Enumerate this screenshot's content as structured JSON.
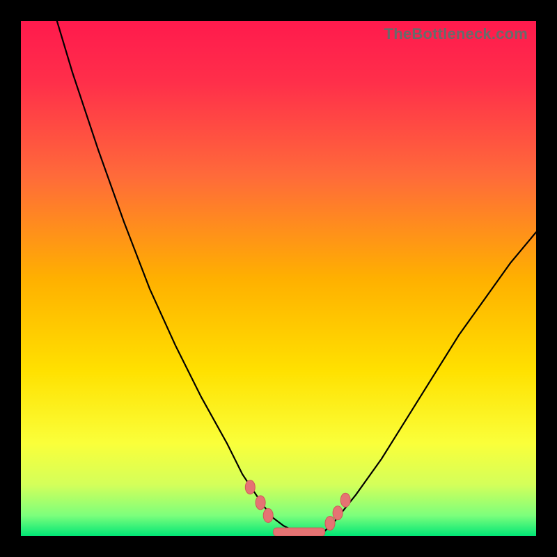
{
  "watermark": "TheBottleneck.com",
  "colors": {
    "frame": "#000000",
    "gradient_stops": [
      {
        "offset": 0.0,
        "color": "#ff1a4d"
      },
      {
        "offset": 0.12,
        "color": "#ff2f4a"
      },
      {
        "offset": 0.3,
        "color": "#ff6a3a"
      },
      {
        "offset": 0.5,
        "color": "#ffb000"
      },
      {
        "offset": 0.68,
        "color": "#ffe100"
      },
      {
        "offset": 0.82,
        "color": "#faff3a"
      },
      {
        "offset": 0.9,
        "color": "#d4ff5a"
      },
      {
        "offset": 0.96,
        "color": "#7cff7c"
      },
      {
        "offset": 1.0,
        "color": "#00e676"
      }
    ],
    "curve": "#000000",
    "marker_fill": "#e57373",
    "marker_stroke": "#d05858"
  },
  "chart_data": {
    "type": "line",
    "title": "",
    "xlabel": "",
    "ylabel": "",
    "xlim": [
      0,
      100
    ],
    "ylim": [
      0,
      100
    ],
    "grid": false,
    "legend": false,
    "series": [
      {
        "name": "bottleneck-curve",
        "x": [
          7,
          10,
          15,
          20,
          25,
          30,
          35,
          40,
          43,
          45,
          47,
          49,
          51,
          53,
          55,
          57,
          59,
          61,
          65,
          70,
          75,
          80,
          85,
          90,
          95,
          100
        ],
        "y": [
          100,
          90,
          75,
          61,
          48,
          37,
          27,
          18,
          12,
          9,
          6,
          3.5,
          2,
          1,
          0.5,
          0.5,
          1,
          3,
          8,
          15,
          23,
          31,
          39,
          46,
          53,
          59
        ]
      }
    ],
    "markers": {
      "name": "highlighted-points",
      "x": [
        44.5,
        46.5,
        48.0,
        60.0,
        61.5,
        63.0
      ],
      "y": [
        9.5,
        6.5,
        4.0,
        2.5,
        4.5,
        7.0
      ]
    },
    "trough_bar": {
      "x_start": 49,
      "x_end": 59,
      "y": 0.8
    }
  }
}
